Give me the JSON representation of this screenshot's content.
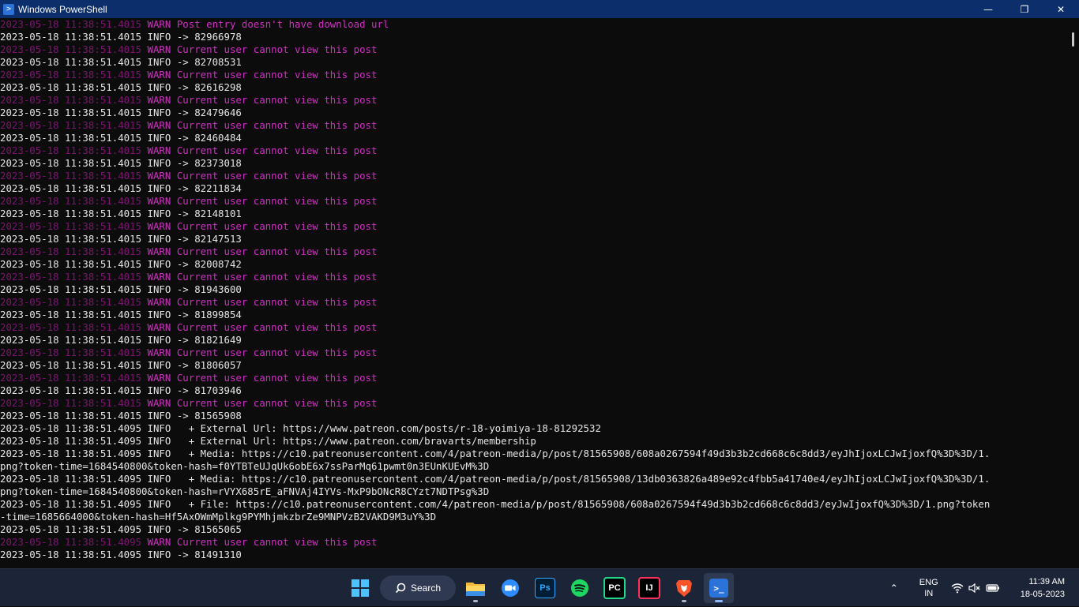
{
  "window": {
    "title": "Windows PowerShell"
  },
  "titlebar_buttons": {
    "minimize": "—",
    "maximize": "❐",
    "close": "✕"
  },
  "console_lines": [
    {
      "ts": "2023-05-18 11:38:51.4015",
      "level": "WARN",
      "msg": "Post entry doesn't have download url"
    },
    {
      "ts": "2023-05-18 11:38:51.4015",
      "level": "INFO",
      "msg": "-> 82966978"
    },
    {
      "ts": "2023-05-18 11:38:51.4015",
      "level": "WARN",
      "msg": "Current user cannot view this post"
    },
    {
      "ts": "2023-05-18 11:38:51.4015",
      "level": "INFO",
      "msg": "-> 82708531"
    },
    {
      "ts": "2023-05-18 11:38:51.4015",
      "level": "WARN",
      "msg": "Current user cannot view this post"
    },
    {
      "ts": "2023-05-18 11:38:51.4015",
      "level": "INFO",
      "msg": "-> 82616298"
    },
    {
      "ts": "2023-05-18 11:38:51.4015",
      "level": "WARN",
      "msg": "Current user cannot view this post"
    },
    {
      "ts": "2023-05-18 11:38:51.4015",
      "level": "INFO",
      "msg": "-> 82479646"
    },
    {
      "ts": "2023-05-18 11:38:51.4015",
      "level": "WARN",
      "msg": "Current user cannot view this post"
    },
    {
      "ts": "2023-05-18 11:38:51.4015",
      "level": "INFO",
      "msg": "-> 82460484"
    },
    {
      "ts": "2023-05-18 11:38:51.4015",
      "level": "WARN",
      "msg": "Current user cannot view this post"
    },
    {
      "ts": "2023-05-18 11:38:51.4015",
      "level": "INFO",
      "msg": "-> 82373018"
    },
    {
      "ts": "2023-05-18 11:38:51.4015",
      "level": "WARN",
      "msg": "Current user cannot view this post"
    },
    {
      "ts": "2023-05-18 11:38:51.4015",
      "level": "INFO",
      "msg": "-> 82211834"
    },
    {
      "ts": "2023-05-18 11:38:51.4015",
      "level": "WARN",
      "msg": "Current user cannot view this post"
    },
    {
      "ts": "2023-05-18 11:38:51.4015",
      "level": "INFO",
      "msg": "-> 82148101"
    },
    {
      "ts": "2023-05-18 11:38:51.4015",
      "level": "WARN",
      "msg": "Current user cannot view this post"
    },
    {
      "ts": "2023-05-18 11:38:51.4015",
      "level": "INFO",
      "msg": "-> 82147513"
    },
    {
      "ts": "2023-05-18 11:38:51.4015",
      "level": "WARN",
      "msg": "Current user cannot view this post"
    },
    {
      "ts": "2023-05-18 11:38:51.4015",
      "level": "INFO",
      "msg": "-> 82008742"
    },
    {
      "ts": "2023-05-18 11:38:51.4015",
      "level": "WARN",
      "msg": "Current user cannot view this post"
    },
    {
      "ts": "2023-05-18 11:38:51.4015",
      "level": "INFO",
      "msg": "-> 81943600"
    },
    {
      "ts": "2023-05-18 11:38:51.4015",
      "level": "WARN",
      "msg": "Current user cannot view this post"
    },
    {
      "ts": "2023-05-18 11:38:51.4015",
      "level": "INFO",
      "msg": "-> 81899854"
    },
    {
      "ts": "2023-05-18 11:38:51.4015",
      "level": "WARN",
      "msg": "Current user cannot view this post"
    },
    {
      "ts": "2023-05-18 11:38:51.4015",
      "level": "INFO",
      "msg": "-> 81821649"
    },
    {
      "ts": "2023-05-18 11:38:51.4015",
      "level": "WARN",
      "msg": "Current user cannot view this post"
    },
    {
      "ts": "2023-05-18 11:38:51.4015",
      "level": "INFO",
      "msg": "-> 81806057"
    },
    {
      "ts": "2023-05-18 11:38:51.4015",
      "level": "WARN",
      "msg": "Current user cannot view this post"
    },
    {
      "ts": "2023-05-18 11:38:51.4015",
      "level": "INFO",
      "msg": "-> 81703946"
    },
    {
      "ts": "2023-05-18 11:38:51.4015",
      "level": "WARN",
      "msg": "Current user cannot view this post"
    },
    {
      "ts": "2023-05-18 11:38:51.4015",
      "level": "INFO",
      "msg": "-> 81565908"
    },
    {
      "ts": "2023-05-18 11:38:51.4095",
      "level": "INFO",
      "msg": "  + External Url: https://www.patreon.com/posts/r-18-yoimiya-18-81292532"
    },
    {
      "ts": "2023-05-18 11:38:51.4095",
      "level": "INFO",
      "msg": "  + External Url: https://www.patreon.com/bravarts/membership"
    },
    {
      "ts": "2023-05-18 11:38:51.4095",
      "level": "INFO",
      "msg": "  + Media: https://c10.patreonusercontent.com/4/patreon-media/p/post/81565908/608a0267594f49d3b3b2cd668c6c8dd3/eyJhIjoxLCJwIjoxfQ%3D%3D/1."
    },
    {
      "ts": "",
      "level": "",
      "msg": "png?token-time=1684540800&token-hash=f0YTBTeUJqUk6obE6x7ssParMq61pwmt0n3EUnKUEvM%3D"
    },
    {
      "ts": "2023-05-18 11:38:51.4095",
      "level": "INFO",
      "msg": "  + Media: https://c10.patreonusercontent.com/4/patreon-media/p/post/81565908/13db0363826a489e92c4fbb5a41740e4/eyJhIjoxLCJwIjoxfQ%3D%3D/1."
    },
    {
      "ts": "",
      "level": "",
      "msg": "png?token-time=1684540800&token-hash=rVYX685rE_aFNVAj4IYVs-MxP9bONcR8CYzt7NDTPsg%3D"
    },
    {
      "ts": "2023-05-18 11:38:51.4095",
      "level": "INFO",
      "msg": "  + File: https://c10.patreonusercontent.com/4/patreon-media/p/post/81565908/608a0267594f49d3b3b2cd668c6c8dd3/eyJwIjoxfQ%3D%3D/1.png?token"
    },
    {
      "ts": "",
      "level": "",
      "msg": "-time=1685664000&token-hash=Hf5AxOWmMplkg9PYMhjmkzbrZe9MNPVzB2VAKD9M3uY%3D"
    },
    {
      "ts": "2023-05-18 11:38:51.4095",
      "level": "INFO",
      "msg": "-> 81565065"
    },
    {
      "ts": "2023-05-18 11:38:51.4095",
      "level": "WARN",
      "msg": "Current user cannot view this post"
    },
    {
      "ts": "2023-05-18 11:38:51.4095",
      "level": "INFO",
      "msg": "-> 81491310"
    }
  ],
  "taskbar": {
    "search_label": "Search",
    "apps": [
      {
        "name": "start",
        "icon": "windows-logo"
      },
      {
        "name": "search",
        "icon": "search-icon"
      },
      {
        "name": "file-explorer",
        "icon": "folder-icon"
      },
      {
        "name": "zoom",
        "icon": "zoom-icon"
      },
      {
        "name": "photoshop",
        "icon": "photoshop-icon",
        "label": "Ps"
      },
      {
        "name": "spotify",
        "icon": "spotify-icon"
      },
      {
        "name": "pycharm",
        "icon": "pycharm-icon",
        "label": "PC"
      },
      {
        "name": "intellij",
        "icon": "intellij-icon",
        "label": "IJ"
      },
      {
        "name": "brave",
        "icon": "brave-icon"
      },
      {
        "name": "powershell",
        "icon": "powershell-icon"
      }
    ],
    "tray": {
      "lang_top": "ENG",
      "lang_bottom": "IN",
      "time": "11:39 AM",
      "date": "18-05-2023"
    }
  },
  "colors": {
    "titlebar": "#0c2f6b",
    "console_bg": "#0c0c0c",
    "warn_magenta": "#d02fc4",
    "taskbar": "#1c2538"
  }
}
